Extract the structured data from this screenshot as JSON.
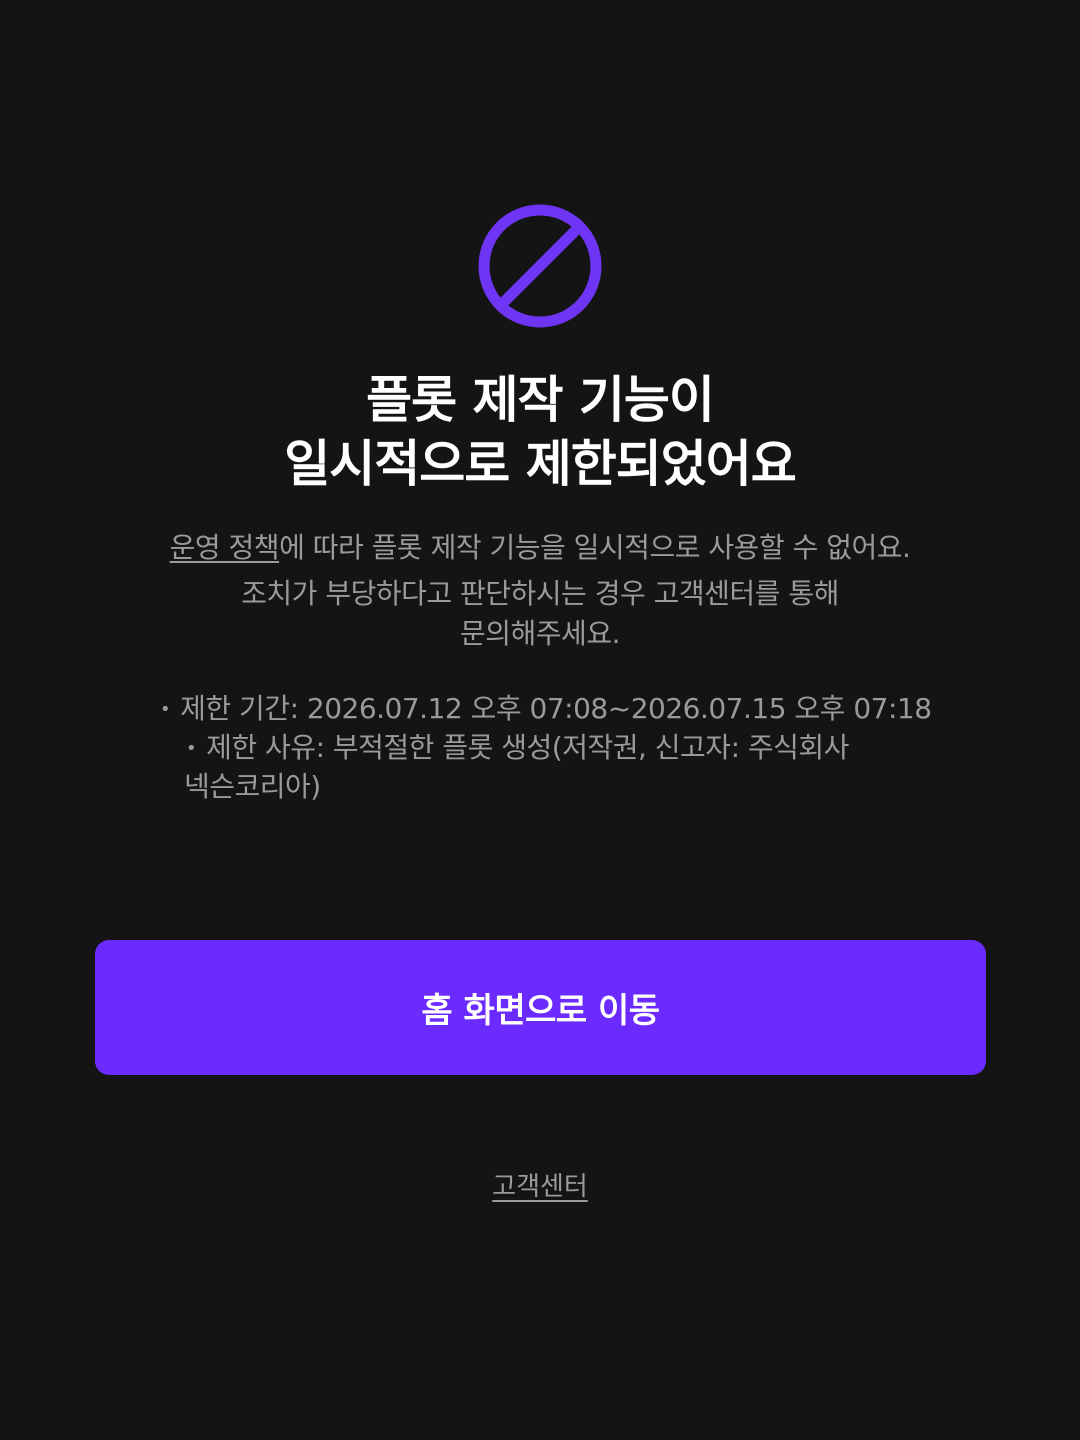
{
  "colors": {
    "background": "#141414",
    "accent": "#6b2bff",
    "icon": "#6f35f5",
    "text_primary": "#ffffff",
    "text_secondary": "#9a9a9a"
  },
  "icon": "prohibited-icon",
  "title": {
    "line1": "플롯 제작 기능이",
    "line2": "일시적으로 제한되었어요"
  },
  "description": {
    "policy_link": "운영 정책",
    "line1_rest": "에 따라 플롯 제작 기능을 일시적으로 사용할 수 없어요.",
    "line2": "조치가 부당하다고 판단하시는 경우 고객센터를 통해",
    "line3": "문의해주세요."
  },
  "details": {
    "bullet": "•",
    "period": "제한 기간: 2026.07.12 오후 07:08~2026.07.15 오후 07:18",
    "reason_line1": "제한 사유: 부적절한 플롯 생성(저작권, 신고자: 주식회사",
    "reason_line2": "넥슨코리아)"
  },
  "home_button_label": "홈 화면으로 이동",
  "support_link_label": "고객센터"
}
